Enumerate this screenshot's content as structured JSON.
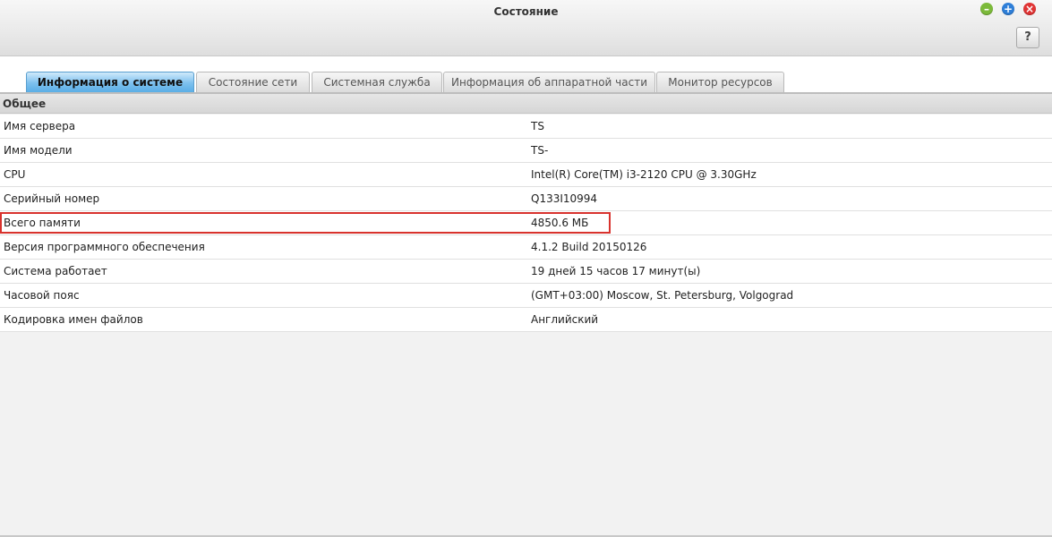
{
  "window": {
    "title": "Состояние",
    "help_label": "?",
    "minimize_glyph": "–",
    "maximize_glyph": "+",
    "close_glyph": "×"
  },
  "tabs": [
    {
      "label": "Информация о системе",
      "active": true
    },
    {
      "label": "Состояние сети",
      "active": false
    },
    {
      "label": "Системная служба",
      "active": false
    },
    {
      "label": "Информация об аппаратной части",
      "active": false
    },
    {
      "label": "Монитор ресурсов",
      "active": false
    }
  ],
  "section": {
    "title": "Общее"
  },
  "rows": [
    {
      "label": "Имя сервера",
      "value": "TS"
    },
    {
      "label": "Имя модели",
      "value": "TS-"
    },
    {
      "label": "CPU",
      "value": "Intel(R) Core(TM) i3-2120 CPU @ 3.30GHz"
    },
    {
      "label": "Серийный номер",
      "value": "Q133I10994"
    },
    {
      "label": "Всего памяти",
      "value": "4850.6 МБ"
    },
    {
      "label": "Версия программного обеспечения",
      "value": "4.1.2 Build 20150126"
    },
    {
      "label": "Система работает",
      "value": "19 дней 15 часов 17 минут(ы)"
    },
    {
      "label": "Часовой пояс",
      "value": "(GMT+03:00) Moscow, St. Petersburg, Volgograd"
    },
    {
      "label": "Кодировка имен файлов",
      "value": "Английский"
    }
  ],
  "colors": {
    "active_tab": "#5aaee6",
    "highlight_border": "#d8322d",
    "minimize": "#7cba3a",
    "maximize": "#2f7fd8",
    "close": "#e03434"
  }
}
